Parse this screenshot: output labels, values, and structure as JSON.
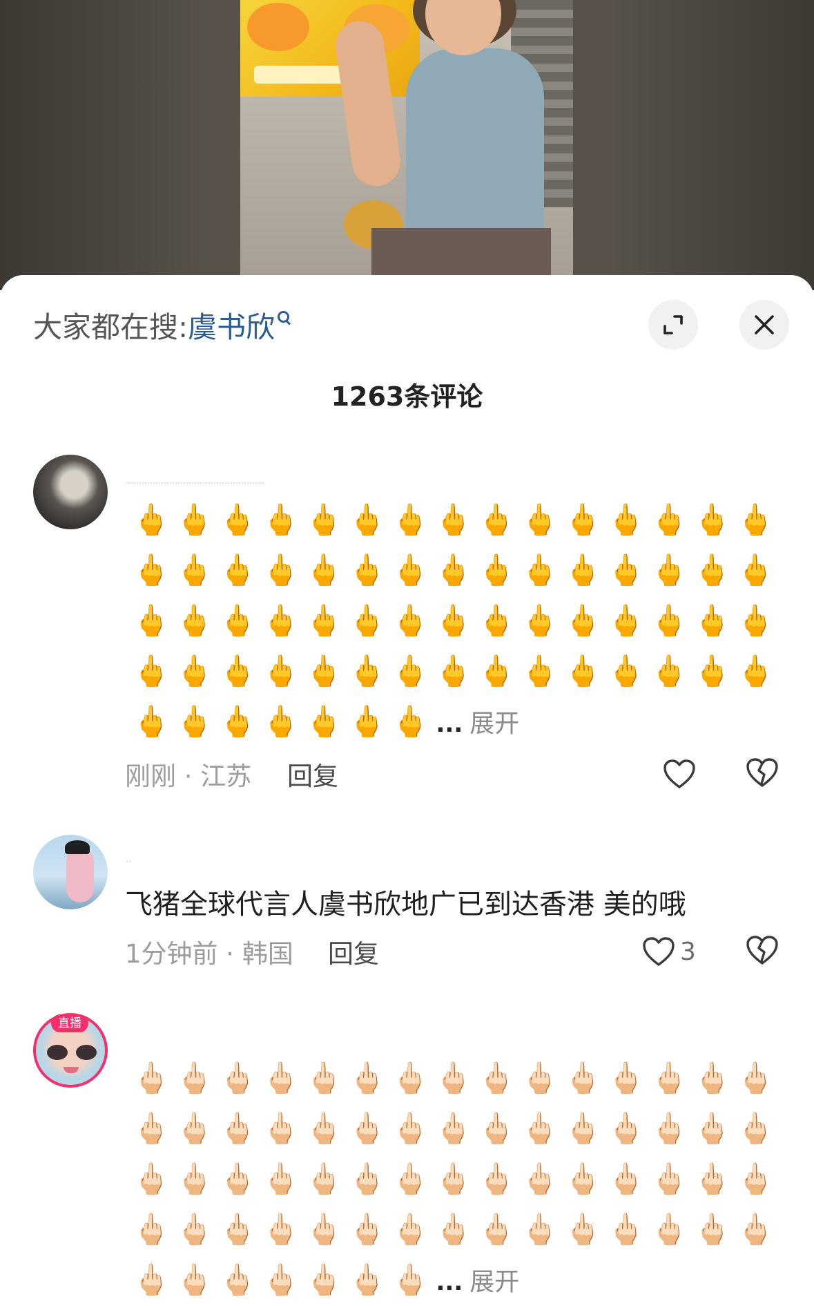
{
  "search_bar": {
    "prefix": "大家都在搜:",
    "term": "虞书欣"
  },
  "header": {
    "comment_count_title": "1263条评论"
  },
  "comments": [
    {
      "emoji": "🖕",
      "emoji_lines_full": 4,
      "emoji_per_line": 15,
      "emoji_last_line": 7,
      "ellipsis": "...",
      "expand_label": "展开",
      "time_location": "刚刚 · 江苏",
      "reply_label": "回复",
      "like_count": ""
    },
    {
      "text": "飞猪全球代言人虞书欣地广已到达香港 美的哦",
      "time_location": "1分钟前 · 韩国",
      "reply_label": "回复",
      "like_count": "3"
    },
    {
      "emoji": "🖕🏻",
      "live_badge": "直播",
      "emoji_lines_full": 4,
      "emoji_per_line": 15,
      "emoji_last_line": 7,
      "ellipsis": "...",
      "expand_label": "展开"
    }
  ],
  "icons": {
    "expand": "expand-icon",
    "close": "close-icon",
    "like": "heart-outline-icon",
    "dislike": "broken-heart-icon",
    "search": "search-icon"
  },
  "colors": {
    "search_term": "#2b5b93",
    "live_badge": "#f2306b",
    "emoji_yellow": "#f2b42a"
  }
}
